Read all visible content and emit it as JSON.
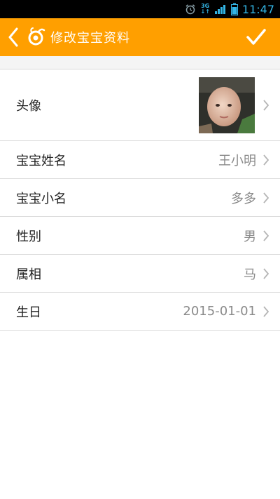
{
  "status_bar": {
    "net_top": "3G",
    "net_bottom": "↓↑",
    "time": "11:47"
  },
  "header": {
    "title": "修改宝宝资料",
    "accent_color": "#ff9f00"
  },
  "rows": [
    {
      "label": "头像",
      "value": ""
    },
    {
      "label": "宝宝姓名",
      "value": "王小明"
    },
    {
      "label": "宝宝小名",
      "value": "多多"
    },
    {
      "label": "性别",
      "value": "男"
    },
    {
      "label": "属相",
      "value": "马"
    },
    {
      "label": "生日",
      "value": "2015-01-01"
    }
  ]
}
